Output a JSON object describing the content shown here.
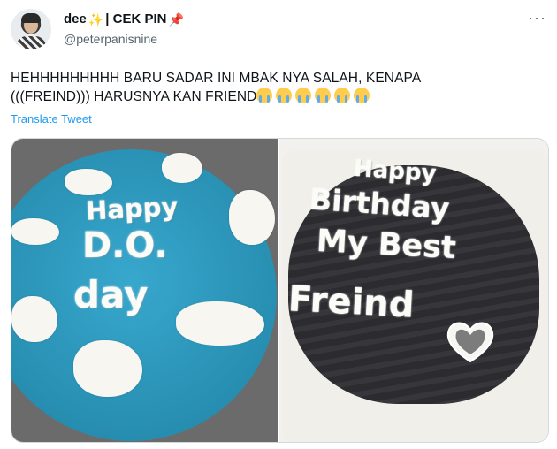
{
  "tweet": {
    "display_name": "dee",
    "name_suffix": "| CEK PIN",
    "handle": "@peterpanisnine",
    "more_icon": "more-options-icon",
    "text_line1": "HEHHHHHHHHH BARU SADAR INI MBAK NYA SALAH, KENAPA",
    "text_line2": "(((FREIND))) HARUSNYA KAN FRIEND",
    "emoji_count": 6,
    "translate_label": "Translate Tweet"
  },
  "photos": {
    "left_cake": {
      "line1": "Happy",
      "line2": "D.O.",
      "line3": "day"
    },
    "right_cake": {
      "line1": "Happy",
      "line2": "Birthday",
      "line3": "My Best",
      "line4": "Freind"
    }
  },
  "colors": {
    "link": "#1d9bf0",
    "blue_cake": "#27a0c9",
    "dark_cake": "#2c2b2f"
  }
}
